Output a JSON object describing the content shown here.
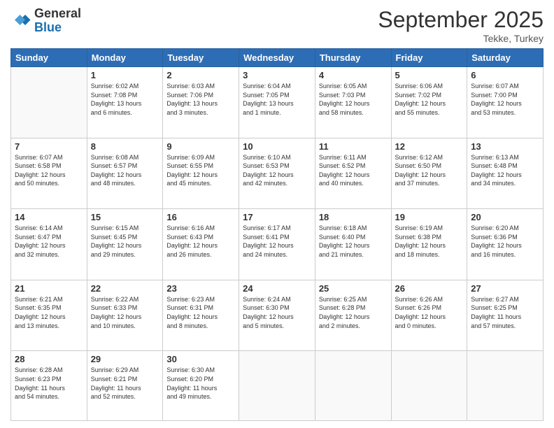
{
  "logo": {
    "general": "General",
    "blue": "Blue"
  },
  "title": "September 2025",
  "subtitle": "Tekke, Turkey",
  "days_header": [
    "Sunday",
    "Monday",
    "Tuesday",
    "Wednesday",
    "Thursday",
    "Friday",
    "Saturday"
  ],
  "weeks": [
    [
      {
        "day": "",
        "info": ""
      },
      {
        "day": "1",
        "info": "Sunrise: 6:02 AM\nSunset: 7:08 PM\nDaylight: 13 hours\nand 6 minutes."
      },
      {
        "day": "2",
        "info": "Sunrise: 6:03 AM\nSunset: 7:06 PM\nDaylight: 13 hours\nand 3 minutes."
      },
      {
        "day": "3",
        "info": "Sunrise: 6:04 AM\nSunset: 7:05 PM\nDaylight: 13 hours\nand 1 minute."
      },
      {
        "day": "4",
        "info": "Sunrise: 6:05 AM\nSunset: 7:03 PM\nDaylight: 12 hours\nand 58 minutes."
      },
      {
        "day": "5",
        "info": "Sunrise: 6:06 AM\nSunset: 7:02 PM\nDaylight: 12 hours\nand 55 minutes."
      },
      {
        "day": "6",
        "info": "Sunrise: 6:07 AM\nSunset: 7:00 PM\nDaylight: 12 hours\nand 53 minutes."
      }
    ],
    [
      {
        "day": "7",
        "info": "Sunrise: 6:07 AM\nSunset: 6:58 PM\nDaylight: 12 hours\nand 50 minutes."
      },
      {
        "day": "8",
        "info": "Sunrise: 6:08 AM\nSunset: 6:57 PM\nDaylight: 12 hours\nand 48 minutes."
      },
      {
        "day": "9",
        "info": "Sunrise: 6:09 AM\nSunset: 6:55 PM\nDaylight: 12 hours\nand 45 minutes."
      },
      {
        "day": "10",
        "info": "Sunrise: 6:10 AM\nSunset: 6:53 PM\nDaylight: 12 hours\nand 42 minutes."
      },
      {
        "day": "11",
        "info": "Sunrise: 6:11 AM\nSunset: 6:52 PM\nDaylight: 12 hours\nand 40 minutes."
      },
      {
        "day": "12",
        "info": "Sunrise: 6:12 AM\nSunset: 6:50 PM\nDaylight: 12 hours\nand 37 minutes."
      },
      {
        "day": "13",
        "info": "Sunrise: 6:13 AM\nSunset: 6:48 PM\nDaylight: 12 hours\nand 34 minutes."
      }
    ],
    [
      {
        "day": "14",
        "info": "Sunrise: 6:14 AM\nSunset: 6:47 PM\nDaylight: 12 hours\nand 32 minutes."
      },
      {
        "day": "15",
        "info": "Sunrise: 6:15 AM\nSunset: 6:45 PM\nDaylight: 12 hours\nand 29 minutes."
      },
      {
        "day": "16",
        "info": "Sunrise: 6:16 AM\nSunset: 6:43 PM\nDaylight: 12 hours\nand 26 minutes."
      },
      {
        "day": "17",
        "info": "Sunrise: 6:17 AM\nSunset: 6:41 PM\nDaylight: 12 hours\nand 24 minutes."
      },
      {
        "day": "18",
        "info": "Sunrise: 6:18 AM\nSunset: 6:40 PM\nDaylight: 12 hours\nand 21 minutes."
      },
      {
        "day": "19",
        "info": "Sunrise: 6:19 AM\nSunset: 6:38 PM\nDaylight: 12 hours\nand 18 minutes."
      },
      {
        "day": "20",
        "info": "Sunrise: 6:20 AM\nSunset: 6:36 PM\nDaylight: 12 hours\nand 16 minutes."
      }
    ],
    [
      {
        "day": "21",
        "info": "Sunrise: 6:21 AM\nSunset: 6:35 PM\nDaylight: 12 hours\nand 13 minutes."
      },
      {
        "day": "22",
        "info": "Sunrise: 6:22 AM\nSunset: 6:33 PM\nDaylight: 12 hours\nand 10 minutes."
      },
      {
        "day": "23",
        "info": "Sunrise: 6:23 AM\nSunset: 6:31 PM\nDaylight: 12 hours\nand 8 minutes."
      },
      {
        "day": "24",
        "info": "Sunrise: 6:24 AM\nSunset: 6:30 PM\nDaylight: 12 hours\nand 5 minutes."
      },
      {
        "day": "25",
        "info": "Sunrise: 6:25 AM\nSunset: 6:28 PM\nDaylight: 12 hours\nand 2 minutes."
      },
      {
        "day": "26",
        "info": "Sunrise: 6:26 AM\nSunset: 6:26 PM\nDaylight: 12 hours\nand 0 minutes."
      },
      {
        "day": "27",
        "info": "Sunrise: 6:27 AM\nSunset: 6:25 PM\nDaylight: 11 hours\nand 57 minutes."
      }
    ],
    [
      {
        "day": "28",
        "info": "Sunrise: 6:28 AM\nSunset: 6:23 PM\nDaylight: 11 hours\nand 54 minutes."
      },
      {
        "day": "29",
        "info": "Sunrise: 6:29 AM\nSunset: 6:21 PM\nDaylight: 11 hours\nand 52 minutes."
      },
      {
        "day": "30",
        "info": "Sunrise: 6:30 AM\nSunset: 6:20 PM\nDaylight: 11 hours\nand 49 minutes."
      },
      {
        "day": "",
        "info": ""
      },
      {
        "day": "",
        "info": ""
      },
      {
        "day": "",
        "info": ""
      },
      {
        "day": "",
        "info": ""
      }
    ]
  ]
}
